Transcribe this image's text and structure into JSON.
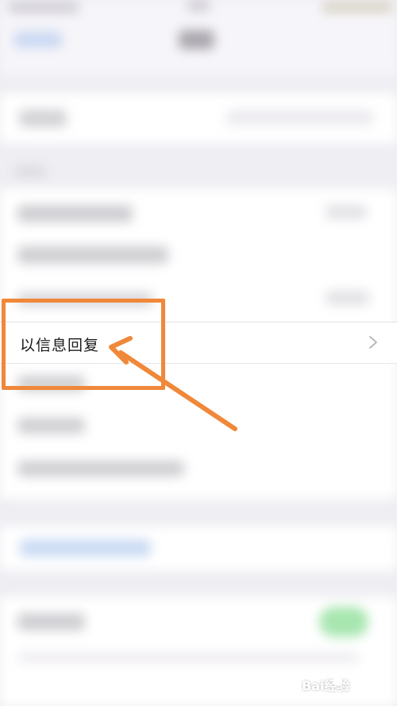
{
  "settings": {
    "highlighted_item": {
      "label": "以信息回复"
    }
  },
  "annotation": {
    "color": "#f0883a"
  },
  "icons": {
    "row_chevron": "chevron-right-icon"
  },
  "watermark": {
    "text": "Bai经验"
  }
}
